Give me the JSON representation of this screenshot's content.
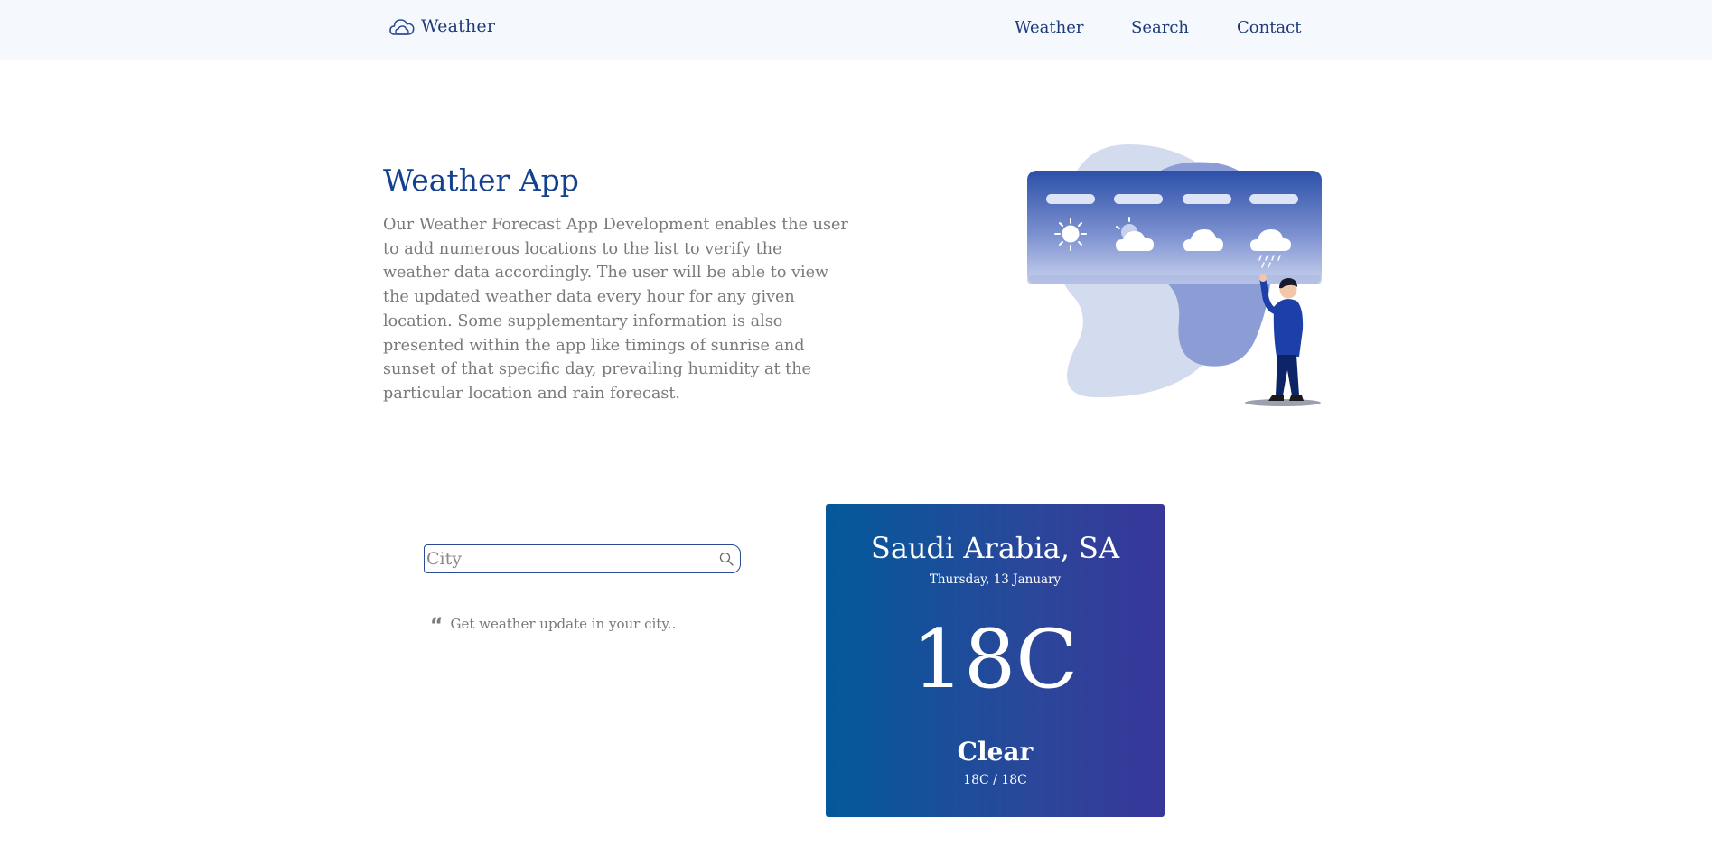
{
  "nav": {
    "brand": "Weather",
    "brand_icon": "cloud-icon",
    "links": [
      "Weather",
      "Search",
      "Contact"
    ]
  },
  "hero": {
    "title": "Weather App",
    "description": "Our Weather Forecast App Development enables the user to add numerous locations to the list to verify the weather data accordingly. The user will be able to view the updated weather data every hour for any given location. Some supplementary information is also presented within the app like timings of sunrise and sunset of that specific day, prevailing humidity at the particular location and rain forecast."
  },
  "search": {
    "placeholder": "City",
    "value": "",
    "icon": "search-icon",
    "tagline_icon": "quote-icon",
    "tagline": "Get weather update in your city.."
  },
  "card": {
    "location": "Saudi Arabia, SA",
    "date": "Thursday, 13 January",
    "temperature": "18C",
    "condition": "Clear",
    "range": "18C / 18C"
  },
  "colors": {
    "accent": "#13408f",
    "nav_bg": "#f5f9fe",
    "card_gradient_start": "#03599a",
    "card_gradient_end": "#37379a"
  }
}
